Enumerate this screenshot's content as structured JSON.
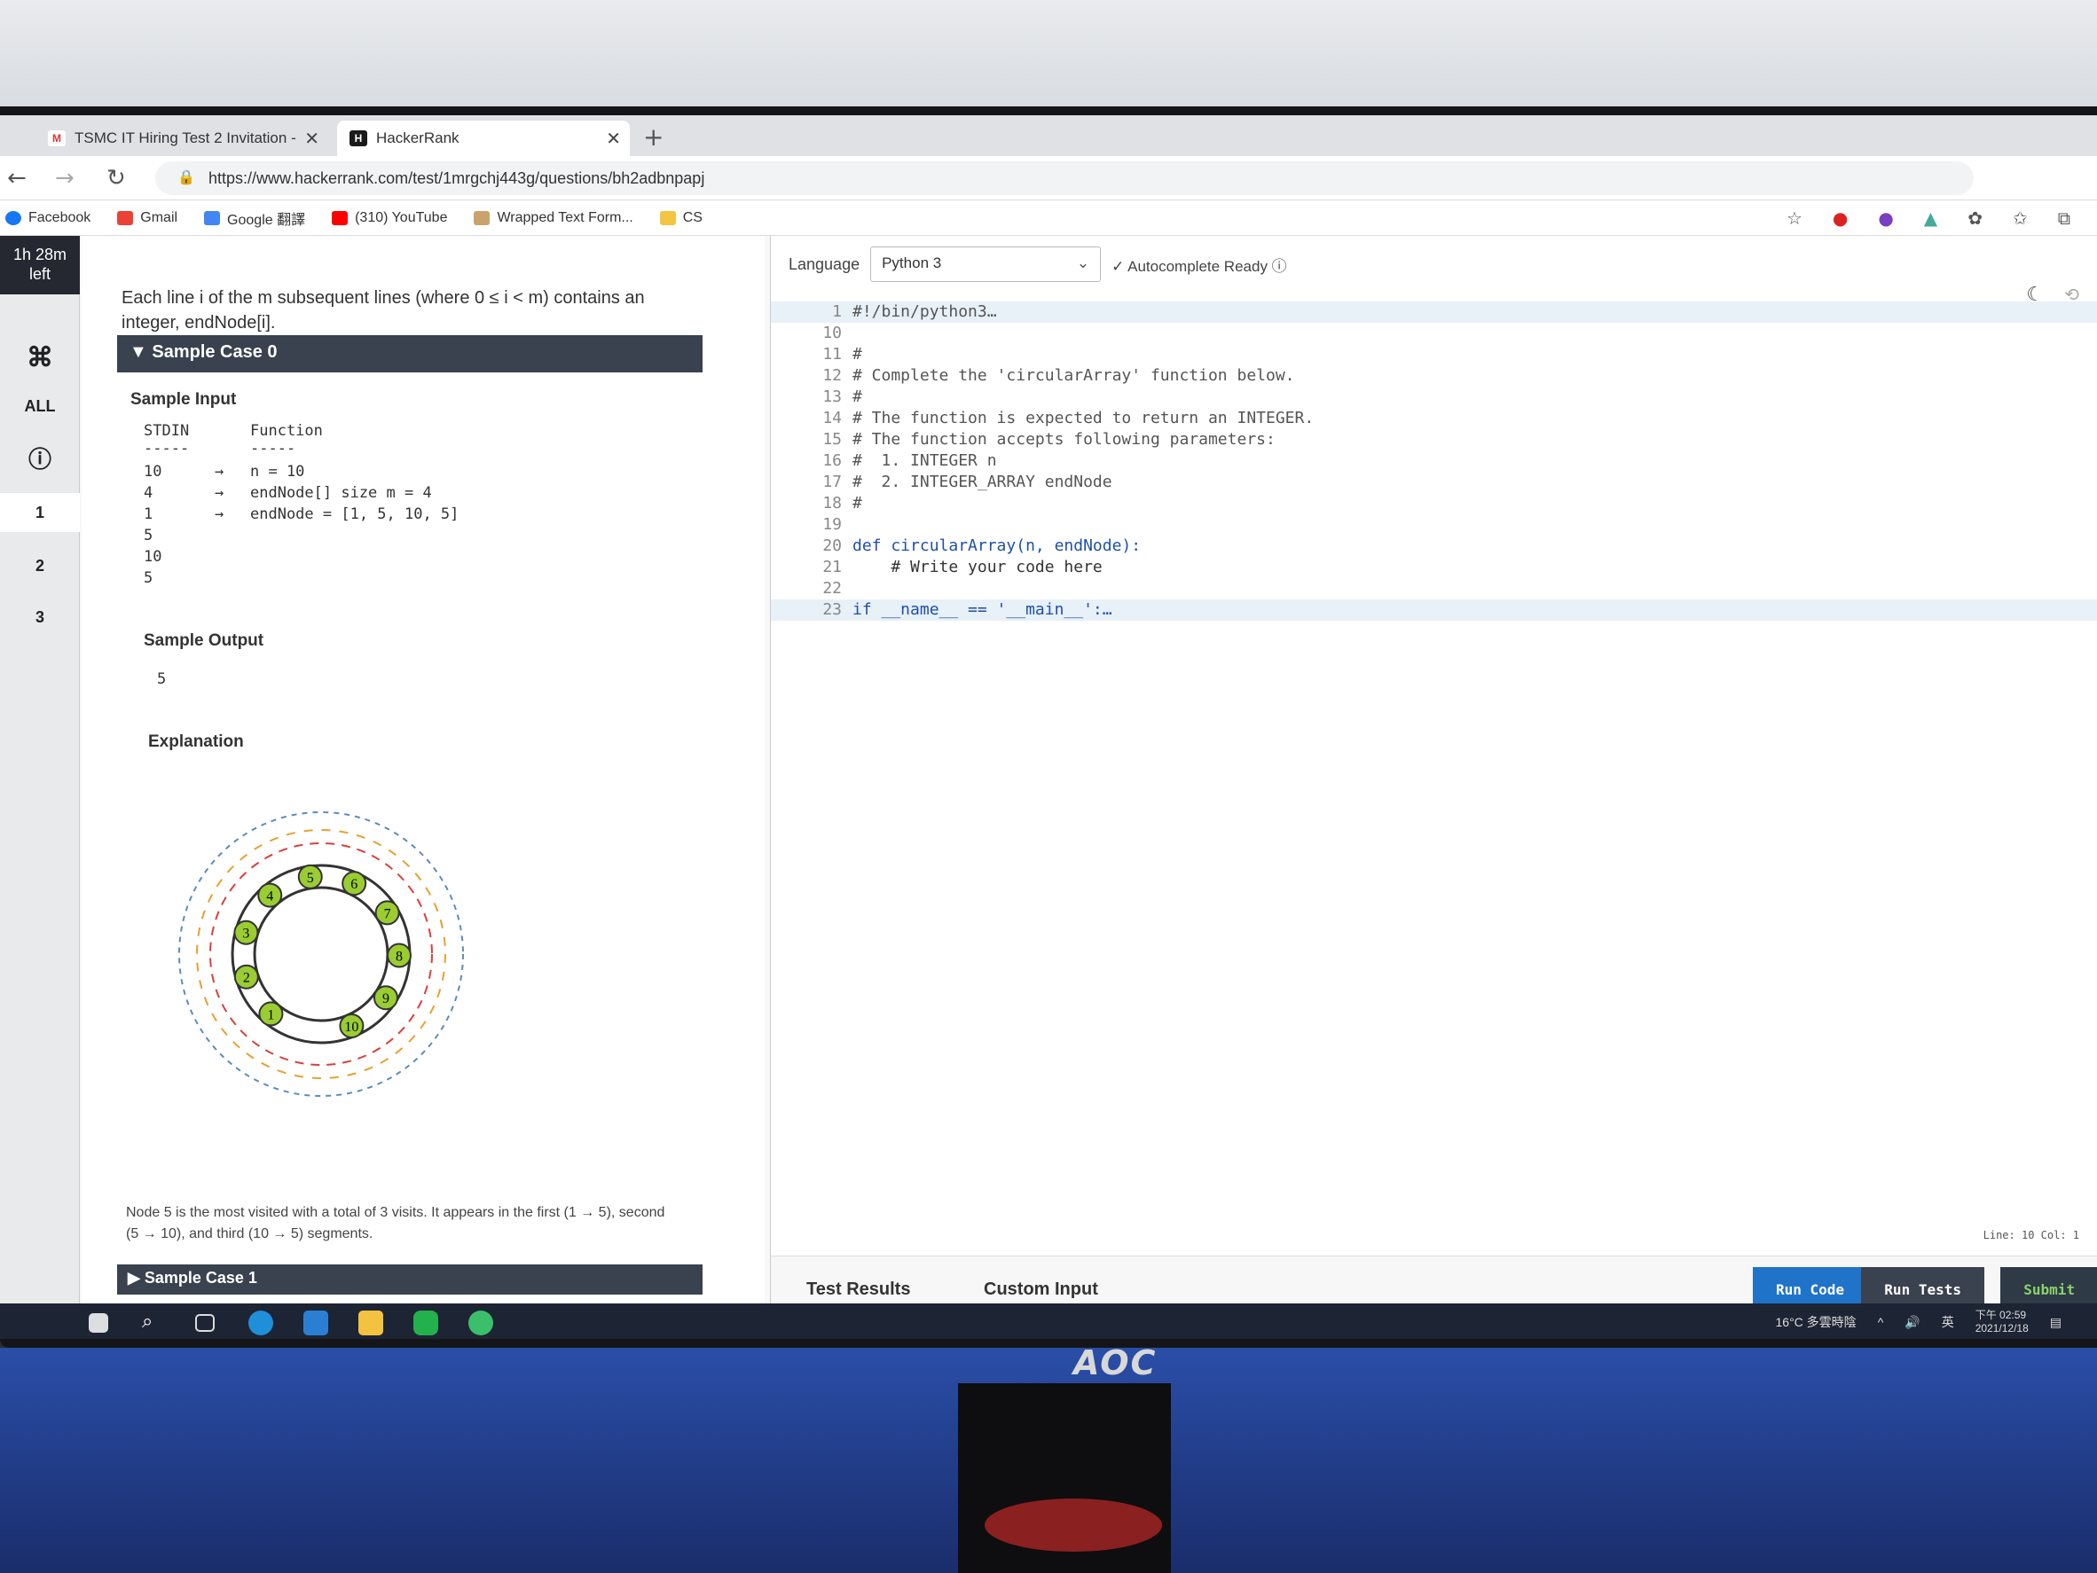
{
  "browser": {
    "tabs": [
      {
        "label": "TSMC IT Hiring Test 2 Invitation -",
        "icon": "gmail-icon",
        "close": "✕"
      },
      {
        "label": "HackerRank",
        "icon": "hackerrank-icon",
        "close": "✕"
      }
    ],
    "new_tab": "+",
    "url": "https://www.hackerrank.com/test/1mrgchj443g/questions/bh2adbnpapj",
    "bookmarks": [
      "Facebook",
      "Gmail",
      "Google 翻譯",
      "(310) YouTube",
      "Wrapped Text Form...",
      "CS"
    ]
  },
  "sidebar": {
    "timer": "1h 28m",
    "timer_sub": "left",
    "shortcut_icon": "⌘",
    "all_label": "ALL",
    "info_icon": "ⓘ",
    "questions": [
      "1",
      "2",
      "3"
    ]
  },
  "problem": {
    "intro": "Each line i of the m subsequent lines (where 0 ≤ i < m) contains an integer, endNode[i].",
    "sample0_title": "Sample Case 0",
    "sample_input_label": "Sample Input",
    "stdin_header": "STDIN",
    "function_header": "Function",
    "dashes": "-----",
    "stdin_lines": [
      "10",
      "4",
      "1",
      "5",
      "10",
      "5"
    ],
    "arrows": [
      "→",
      "→",
      "→"
    ],
    "function_lines": [
      "n = 10",
      "endNode[] size m = 4",
      "endNode = [1, 5, 10, 5]"
    ],
    "sample_output_label": "Sample Output",
    "sample_output": "5",
    "explanation_label": "Explanation",
    "explanation_text": "Node 5 is the most visited with a total of 3 visits. It appears in the first (1 → 5), second (5 → 10), and third (10 → 5) segments.",
    "sample1_title": "Sample Case 1",
    "diagram_nodes": [
      "1",
      "2",
      "3",
      "4",
      "5",
      "6",
      "7",
      "8",
      "9",
      "10"
    ]
  },
  "editor": {
    "language_label": "Language",
    "language": "Python 3",
    "autocomplete": "Autocomplete Ready",
    "lines": [
      {
        "n": "1",
        "t": "#!/bin/python3…",
        "hl": true
      },
      {
        "n": "10",
        "t": ""
      },
      {
        "n": "11",
        "t": "#"
      },
      {
        "n": "12",
        "t": "# Complete the 'circularArray' function below."
      },
      {
        "n": "13",
        "t": "#"
      },
      {
        "n": "14",
        "t": "# The function is expected to return an INTEGER."
      },
      {
        "n": "15",
        "t": "# The function accepts following parameters:"
      },
      {
        "n": "16",
        "t": "#  1. INTEGER n"
      },
      {
        "n": "17",
        "t": "#  2. INTEGER_ARRAY endNode"
      },
      {
        "n": "18",
        "t": "#"
      },
      {
        "n": "19",
        "t": ""
      },
      {
        "n": "20",
        "t": "def circularArray(n, endNode):"
      },
      {
        "n": "21",
        "t": "    # Write your code here"
      },
      {
        "n": "22",
        "t": ""
      },
      {
        "n": "23",
        "t": "if __name__ == '__main__':…",
        "hl": true
      }
    ],
    "status": "Line: 10 Col: 1",
    "bottom_tabs": [
      "Test Results",
      "Custom Input"
    ],
    "run_code": "Run Code",
    "run_tests": "Run Tests",
    "submit": "Submit",
    "colors": {
      "run_code": "#1f74c9",
      "run_tests": "#39424e",
      "submit": "#2e3a45"
    }
  },
  "taskbar": {
    "weather": "16°C 多雲時陰",
    "ime": "英",
    "time": "下午 02:59",
    "date": "2021/12/18"
  },
  "monitor": {
    "brand": "AOC"
  }
}
